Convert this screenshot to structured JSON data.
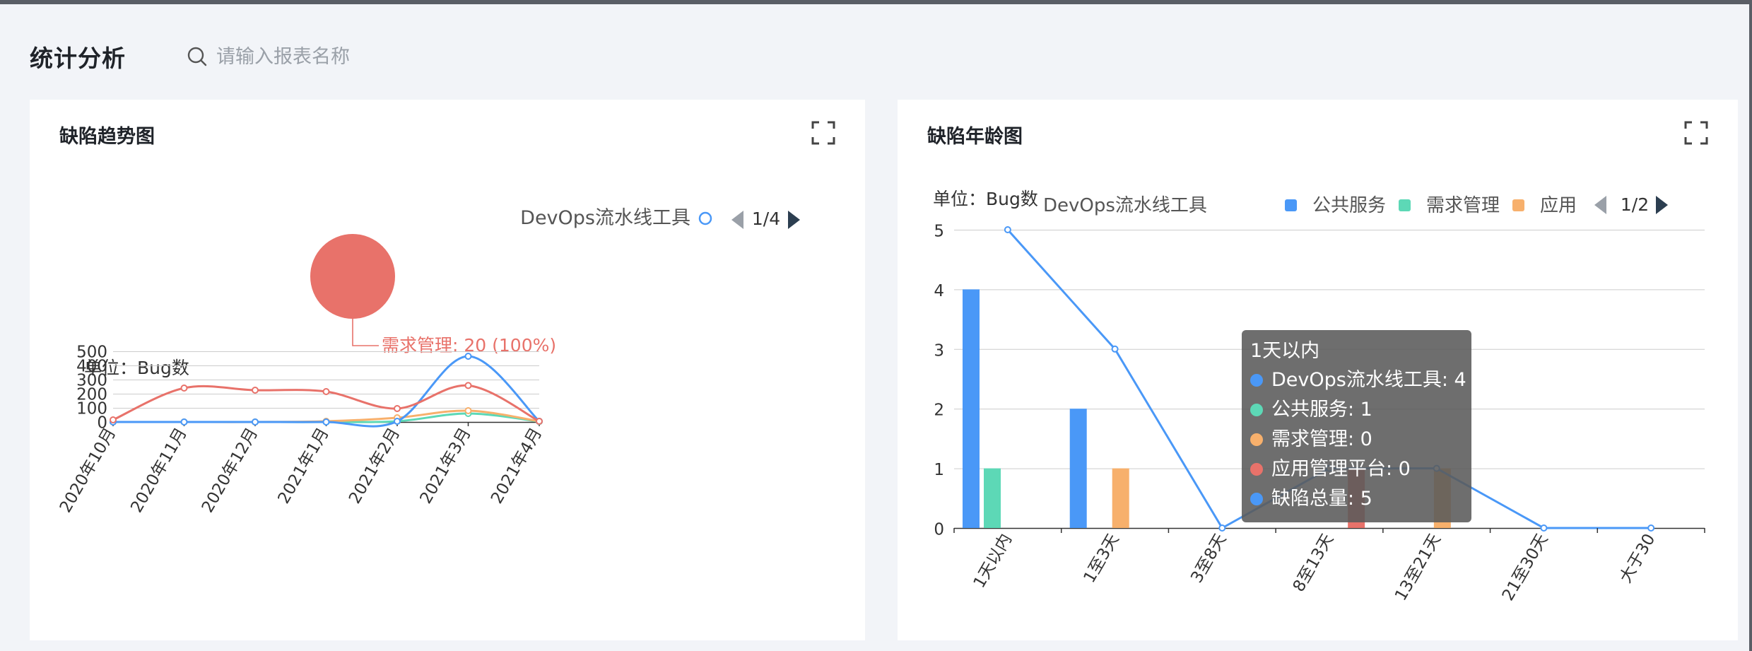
{
  "page": {
    "title": "统计分析",
    "search": {
      "placeholder": "请输入报表名称",
      "value": ""
    }
  },
  "colors": {
    "devops": "#4a98f7",
    "public": "#5dd8b6",
    "demand": "#f7b06c",
    "platform": "#e8726a",
    "total": "#4a98f7",
    "text": "#1f2329",
    "axis": "#333333",
    "grid": "#cccccc",
    "page_bg": "#f2f4f8"
  },
  "icons": {
    "search": "search-icon",
    "fullscreen": "fullscreen-icon",
    "prev": "triangle-left-icon",
    "next": "triangle-right-icon"
  },
  "cards": {
    "trend": {
      "title": "缺陷趋势图"
    },
    "age": {
      "title": "缺陷年龄图"
    }
  },
  "chart_data": [
    {
      "id": "trend",
      "type": "line",
      "title": "缺陷趋势图",
      "unit_label": "单位：Bug数",
      "legend": {
        "visible_item": "DevOps流水线工具",
        "page": "1/4",
        "placement": "top-right"
      },
      "categories": [
        "2020年10月",
        "2020年11月",
        "2020年12月",
        "2021年1月",
        "2021年2月",
        "2021年3月",
        "2021年4月"
      ],
      "yticks": [
        0,
        100,
        200,
        300,
        400,
        500
      ],
      "ylim": [
        0,
        500
      ],
      "smooth": true,
      "series": [
        {
          "color": "#e8726a",
          "values": [
            15,
            240,
            225,
            215,
            95,
            258,
            5
          ]
        },
        {
          "color": "#4a98f7",
          "values": [
            0,
            0,
            0,
            0,
            5,
            465,
            5
          ]
        },
        {
          "color": "#f7b06c",
          "values": [
            0,
            0,
            0,
            5,
            30,
            80,
            5
          ]
        },
        {
          "color": "#5dd8b6",
          "values": [
            0,
            0,
            0,
            0,
            5,
            60,
            3
          ]
        }
      ],
      "pie": {
        "type": "pie",
        "slices": [
          {
            "name": "需求管理",
            "value": 20,
            "percent": "100%"
          }
        ],
        "label": "需求管理: 20 (100%)",
        "color": "#e8726a"
      }
    },
    {
      "id": "age",
      "type": "bar",
      "title": "缺陷年龄图",
      "unit_label": "单位：Bug数",
      "legend": {
        "items": [
          "DevOps流水线工具",
          "公共服务",
          "需求管理",
          "应用管理平台"
        ],
        "visible_text": [
          "DevOps流水线工具",
          "公共服务",
          "需求管理",
          "应用"
        ],
        "page": "1/2",
        "placement": "top-right"
      },
      "categories": [
        "1天以内",
        "1至3天",
        "3至8天",
        "8至13天",
        "13至21天",
        "21至30天",
        "大于30"
      ],
      "yticks": [
        0,
        1,
        2,
        3,
        4,
        5
      ],
      "ylim": [
        0,
        5
      ],
      "grid": true,
      "series": [
        {
          "name": "DevOps流水线工具",
          "type": "bar",
          "color": "#4a98f7",
          "values": [
            4,
            2,
            0,
            0,
            0,
            0,
            0
          ]
        },
        {
          "name": "公共服务",
          "type": "bar",
          "color": "#5dd8b6",
          "values": [
            1,
            0,
            0,
            0,
            0,
            0,
            0
          ]
        },
        {
          "name": "需求管理",
          "type": "bar",
          "color": "#f7b06c",
          "values": [
            0,
            1,
            0,
            0,
            1,
            0,
            0
          ]
        },
        {
          "name": "应用管理平台",
          "type": "bar",
          "color": "#e8726a",
          "values": [
            0,
            0,
            0,
            1,
            0,
            0,
            0
          ]
        },
        {
          "name": "缺陷总量",
          "type": "line",
          "color": "#4a98f7",
          "values": [
            5,
            3,
            0,
            1,
            1,
            0,
            0
          ]
        }
      ],
      "tooltip": {
        "title": "1天以内",
        "rows": [
          {
            "name": "DevOps流水线工具",
            "value": 4,
            "text": "DevOps流水线工具: 4",
            "color": "#4a98f7"
          },
          {
            "name": "公共服务",
            "value": 1,
            "text": "公共服务: 1",
            "color": "#5dd8b6"
          },
          {
            "name": "需求管理",
            "value": 0,
            "text": "需求管理: 0",
            "color": "#f7b06c"
          },
          {
            "name": "应用管理平台",
            "value": 0,
            "text": "应用管理平台: 0",
            "color": "#e8726a"
          },
          {
            "name": "缺陷总量",
            "value": 5,
            "text": "缺陷总量: 5",
            "color": "#4a98f7"
          }
        ]
      }
    }
  ]
}
